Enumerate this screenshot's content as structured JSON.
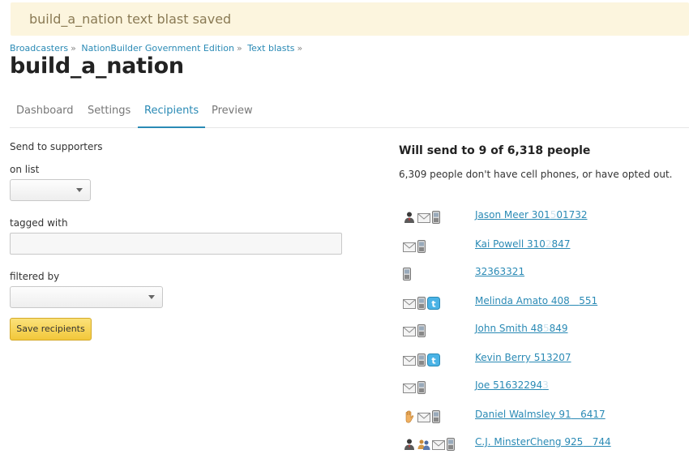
{
  "flash": {
    "message": "build_a_nation text blast saved"
  },
  "breadcrumb": {
    "items": [
      "Broadcasters",
      "NationBuilder Government Edition",
      "Text blasts"
    ],
    "separator": "»"
  },
  "page": {
    "title": "build_a_nation"
  },
  "tabs": [
    {
      "label": "Dashboard",
      "active": false
    },
    {
      "label": "Settings",
      "active": false
    },
    {
      "label": "Recipients",
      "active": true
    },
    {
      "label": "Preview",
      "active": false
    }
  ],
  "form": {
    "send_to_label": "Send to supporters",
    "on_list_label": "on list",
    "on_list_value": "",
    "tagged_with_label": "tagged with",
    "tagged_with_value": "",
    "filtered_by_label": "filtered by",
    "filtered_by_value": "",
    "save_label": "Save recipients"
  },
  "summary": {
    "title": "Will send to 9 of 6,318 people",
    "note": "6,309 people don't have cell phones, or have opted out."
  },
  "recipients": [
    {
      "icons": [
        "person-icon",
        "email-icon",
        "phone-icon"
      ],
      "name": "Jason Meer 301",
      "faded": "5",
      "tail": "01732"
    },
    {
      "icons": [
        "email-icon",
        "phone-icon"
      ],
      "name": "Kai Powell 310",
      "faded": "2",
      "tail": "847"
    },
    {
      "icons": [
        "phone-icon"
      ],
      "name": "32363321",
      "faded": "",
      "tail": ""
    },
    {
      "icons": [
        "email-icon",
        "phone-icon",
        "twitter-icon"
      ],
      "name": "Melinda Amato 408",
      "faded": "",
      "tail": "551"
    },
    {
      "icons": [
        "email-icon",
        "phone-icon"
      ],
      "name": "John Smith 48",
      "faded": "5",
      "tail": "849"
    },
    {
      "icons": [
        "email-icon",
        "phone-icon",
        "twitter-icon"
      ],
      "name": "Kevin Berry 513207",
      "faded": "",
      "tail": ""
    },
    {
      "icons": [
        "email-icon",
        "phone-icon"
      ],
      "name": "Joe 51632294",
      "faded": "3",
      "tail": ""
    },
    {
      "icons": [
        "hand-icon",
        "email-icon",
        "phone-icon"
      ],
      "name": "Daniel Walmsley 91",
      "faded": "",
      "tail": "6417"
    },
    {
      "icons": [
        "person-icon",
        "group-icon",
        "email-icon",
        "phone-icon"
      ],
      "name": "C.J. MinsterCheng 925",
      "faded": "",
      "tail": "744"
    }
  ],
  "colors": {
    "link": "#2a8ab5",
    "flash_bg": "#fcf5de",
    "button": "#f2c73a"
  }
}
